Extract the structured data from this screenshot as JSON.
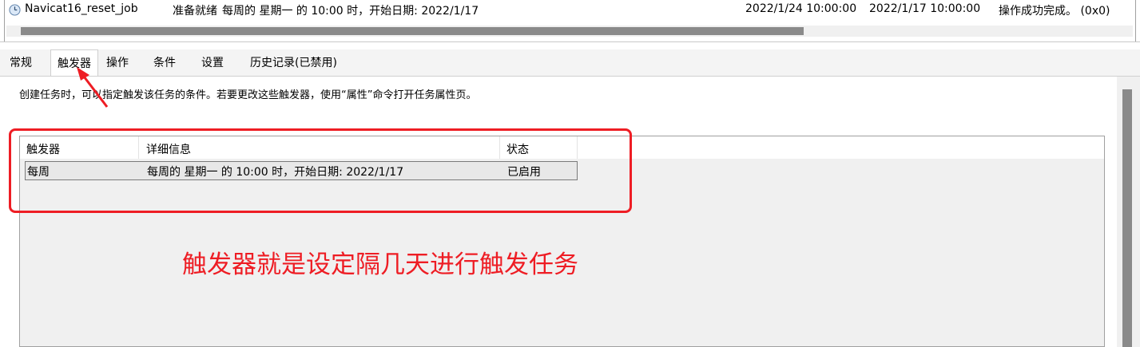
{
  "task": {
    "name": "Navicat16_reset_job",
    "status": "准备就绪",
    "trigger_summary": "每周的 星期一 的 10:00 时，开始日期: 2022/1/17",
    "next_run": "2022/1/24 10:00:00",
    "last_run": "2022/1/17 10:00:00",
    "last_result": "操作成功完成。 (0x0)"
  },
  "tabs": [
    {
      "label": "常规"
    },
    {
      "label": "触发器"
    },
    {
      "label": "操作"
    },
    {
      "label": "条件"
    },
    {
      "label": "设置"
    },
    {
      "label": "历史记录(已禁用)"
    }
  ],
  "active_tab": "触发器",
  "triggers_tab": {
    "description": "创建任务时，可以指定触发该任务的条件。若要更改这些触发器，使用“属性”命令打开任务属性页。",
    "columns": [
      "触发器",
      "详细信息",
      "状态"
    ],
    "rows": [
      {
        "trigger": "每周",
        "details": "每周的 星期一 的 10:00 时，开始日期: 2022/1/17",
        "status": "已启用"
      }
    ]
  },
  "annotation": {
    "text": "触发器就是设定隔几天进行触发任务",
    "color": "#ee1d24"
  }
}
